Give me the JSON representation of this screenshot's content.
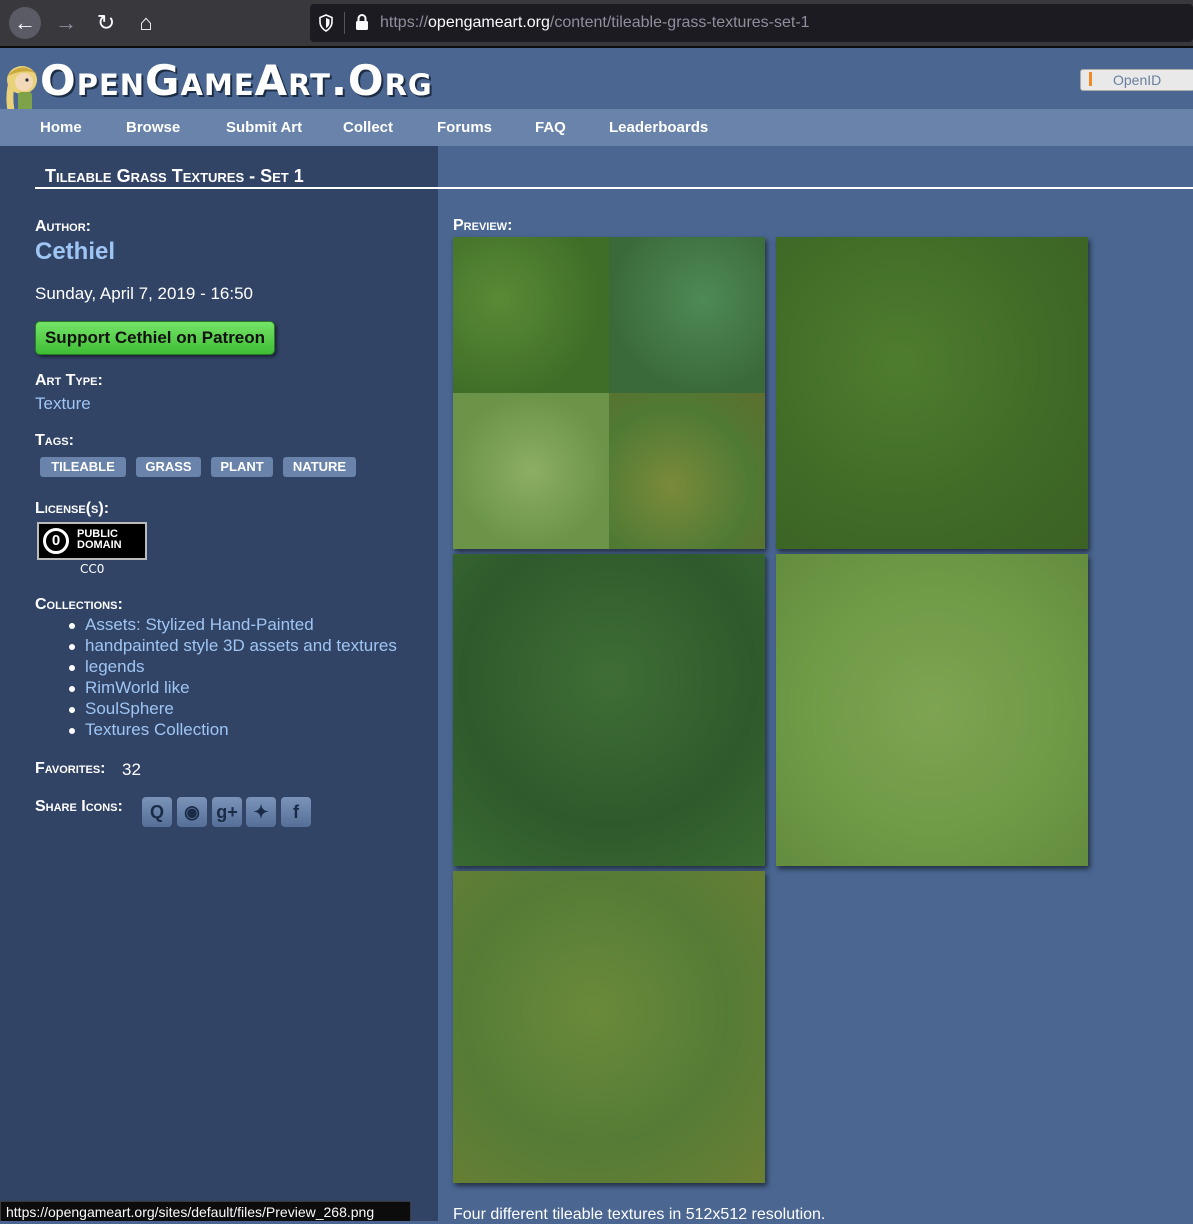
{
  "browser": {
    "url_prefix": "https://",
    "url_domain": "opengameart.org",
    "url_path": "/content/tileable-grass-textures-set-1",
    "status_link": "https://opengameart.org/sites/default/files/Preview_268.png"
  },
  "site": {
    "logo": "OpenGameArt.Org",
    "openid": "OpenID",
    "menu": [
      "Home",
      "Browse",
      "Submit Art",
      "Collect",
      "Forums",
      "FAQ",
      "Leaderboards"
    ]
  },
  "page": {
    "title": "Tileable Grass Textures - Set 1",
    "author_label": "Author:",
    "author": "Cethiel",
    "date": "Sunday, April 7, 2019 - 16:50",
    "patreon_button": "Support Cethiel on Patreon",
    "art_type_label": "Art Type:",
    "art_type": "Texture",
    "tags_label": "Tags:",
    "tags": [
      "TILEABLE",
      "GRASS",
      "PLANT",
      "NATURE"
    ],
    "license_label": "License(s):",
    "license_badge_line1": "PUBLIC",
    "license_badge_line2": "DOMAIN",
    "license_name": "CC0",
    "collections_label": "Collections:",
    "collections": [
      "Assets: Stylized Hand-Painted",
      "handpainted style 3D assets and textures",
      "legends",
      "RimWorld like",
      "SoulSphere",
      "Textures Collection"
    ],
    "favorites_label": "Favorites:",
    "favorites": "32",
    "share_label": "Share Icons:",
    "preview_label": "Preview:",
    "caption": "Four different tileable textures in 512x512 resolution."
  },
  "colors": {
    "page_bg": "#4a6691",
    "sidebar_bg": "#324466",
    "menu_bg": "#6983aa",
    "link": "#9ec5f3",
    "patreon_green": "#4fcf43"
  },
  "icons": {
    "back": "arrow-left-icon",
    "forward": "arrow-right-icon",
    "reload": "reload-icon",
    "home": "home-icon",
    "shield": "shield-icon",
    "lock": "lock-icon",
    "share": [
      "q-icon",
      "reddit-icon",
      "google-plus-icon",
      "twitter-icon",
      "facebook-icon"
    ]
  }
}
